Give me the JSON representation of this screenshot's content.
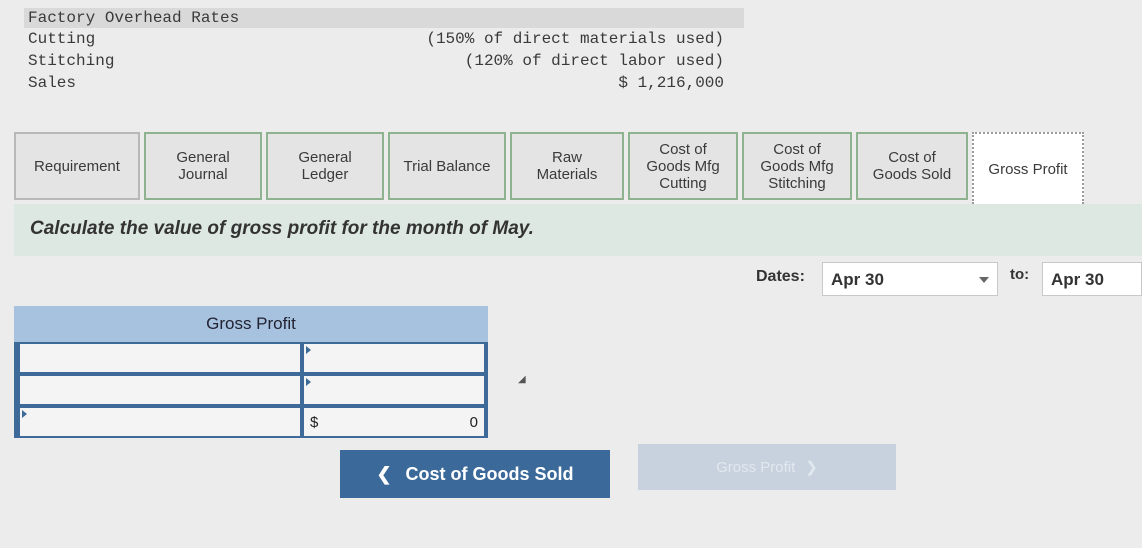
{
  "info": {
    "title": "Factory Overhead Rates",
    "rows": [
      {
        "label": "Cutting",
        "value": "(150% of direct materials used)"
      },
      {
        "label": "Stitching",
        "value": "(120% of direct labor used)"
      },
      {
        "label": "Sales",
        "value": "$ 1,216,000"
      }
    ]
  },
  "tabs": [
    {
      "label": "Requirement"
    },
    {
      "label": "General\nJournal"
    },
    {
      "label": "General\nLedger"
    },
    {
      "label": "Trial Balance"
    },
    {
      "label": "Raw\nMaterials"
    },
    {
      "label": "Cost of\nGoods Mfg\nCutting"
    },
    {
      "label": "Cost of\nGoods Mfg\nStitching"
    },
    {
      "label": "Cost of\nGoods Sold"
    },
    {
      "label": "Gross Profit"
    }
  ],
  "instruction": "Calculate the value of gross profit for the month of May.",
  "dates": {
    "label": "Dates:",
    "from": "Apr 30",
    "to_label": "to:",
    "to": "Apr 30"
  },
  "gross_profit": {
    "header": "Gross Profit",
    "rows": [
      {
        "account": "",
        "amount": ""
      },
      {
        "account": "",
        "amount": ""
      }
    ],
    "total_currency": "$",
    "total_value": "0"
  },
  "nav": {
    "prev_label": "Cost of Goods Sold",
    "next_label": "Gross Profit"
  },
  "colors": {
    "accent": "#3a699a",
    "table_header": "#a7c2df",
    "instruction_bg": "#dde8e2"
  }
}
